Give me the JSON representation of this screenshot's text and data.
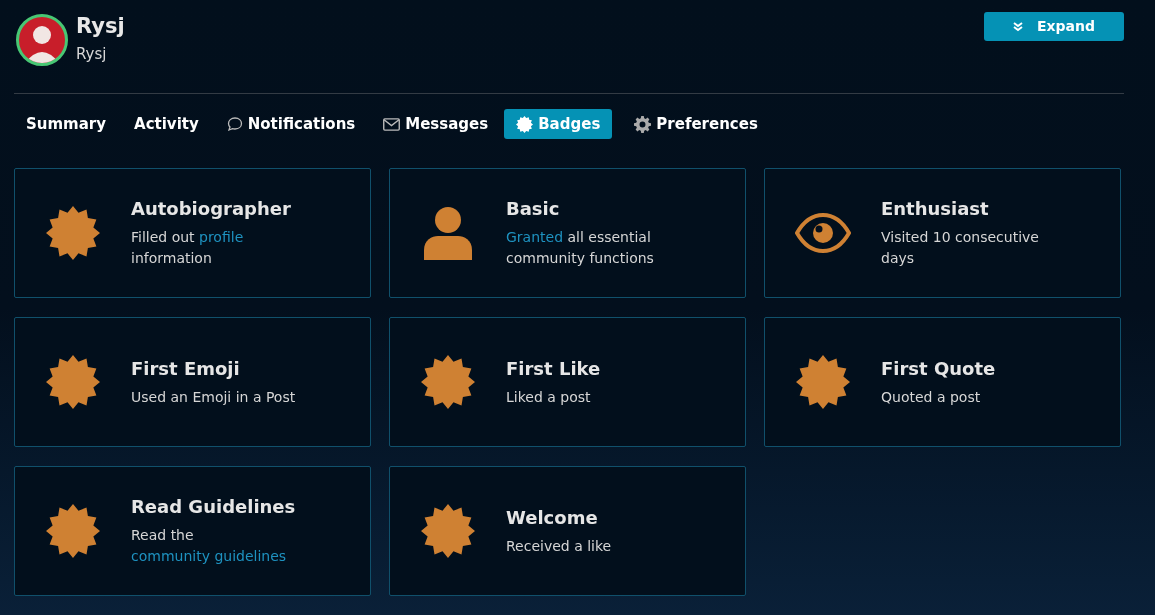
{
  "user": {
    "name": "Rysj",
    "username": "Rysj"
  },
  "expand_button": {
    "label": "Expand"
  },
  "tabs": [
    {
      "label": "Summary",
      "kind": "plain",
      "selected": false
    },
    {
      "label": "Activity",
      "kind": "plain",
      "selected": false
    },
    {
      "label": "Notifications",
      "kind": "bubble",
      "selected": false
    },
    {
      "label": "Messages",
      "kind": "envelope",
      "selected": false
    },
    {
      "label": "Badges",
      "kind": "badge",
      "selected": true
    },
    {
      "label": "Preferences",
      "kind": "gear",
      "selected": false
    }
  ],
  "badges": [
    {
      "title": "Autobiographer",
      "kind": "badge",
      "description": [
        {
          "text": "Filled out "
        },
        {
          "text": "profile",
          "link": true
        },
        {
          "text": " information"
        }
      ]
    },
    {
      "title": "Basic",
      "kind": "user",
      "description": [
        {
          "text": "Granted",
          "link": true
        },
        {
          "text": " all essential community functions"
        }
      ]
    },
    {
      "title": "Enthusiast",
      "kind": "eye",
      "description": [
        {
          "text": "Visited 10 consecutive days"
        }
      ]
    },
    {
      "title": "First Emoji",
      "kind": "badge",
      "description": [
        {
          "text": "Used an Emoji in a Post"
        }
      ]
    },
    {
      "title": "First Like",
      "kind": "badge",
      "description": [
        {
          "text": "Liked a post"
        }
      ]
    },
    {
      "title": "First Quote",
      "kind": "badge",
      "description": [
        {
          "text": "Quoted a post"
        }
      ]
    },
    {
      "title": "Read Guidelines",
      "kind": "badge",
      "description": [
        {
          "text": "Read the "
        },
        {
          "text": "community guidelines",
          "link": true
        }
      ]
    },
    {
      "title": "Welcome",
      "kind": "badge",
      "description": [
        {
          "text": "Received a like"
        }
      ]
    }
  ]
}
